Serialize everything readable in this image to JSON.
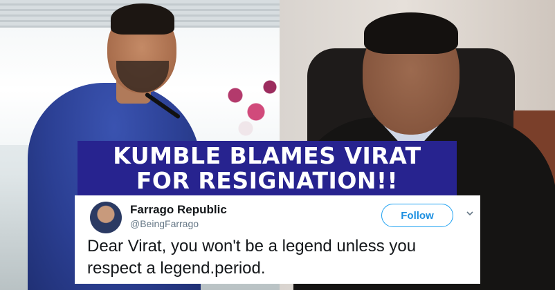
{
  "headline": {
    "line1": "KUMBLE BLAMES VIRAT",
    "line2": "FOR RESIGNATION!!",
    "background_color": "#27238f",
    "text_color": "#ffffff"
  },
  "tweet": {
    "user_name": "Farrago Republic",
    "user_handle": "@BeingFarrago",
    "follow_label": "Follow",
    "text": "Dear Virat, you won't be a legend unless you respect a legend.period.",
    "accent_color": "#1da1f2",
    "icons": [
      "avatar",
      "chevron-down-icon"
    ]
  },
  "photos": {
    "left": "person-in-blue-shirt-speaking",
    "right": "person-in-dark-suit"
  }
}
